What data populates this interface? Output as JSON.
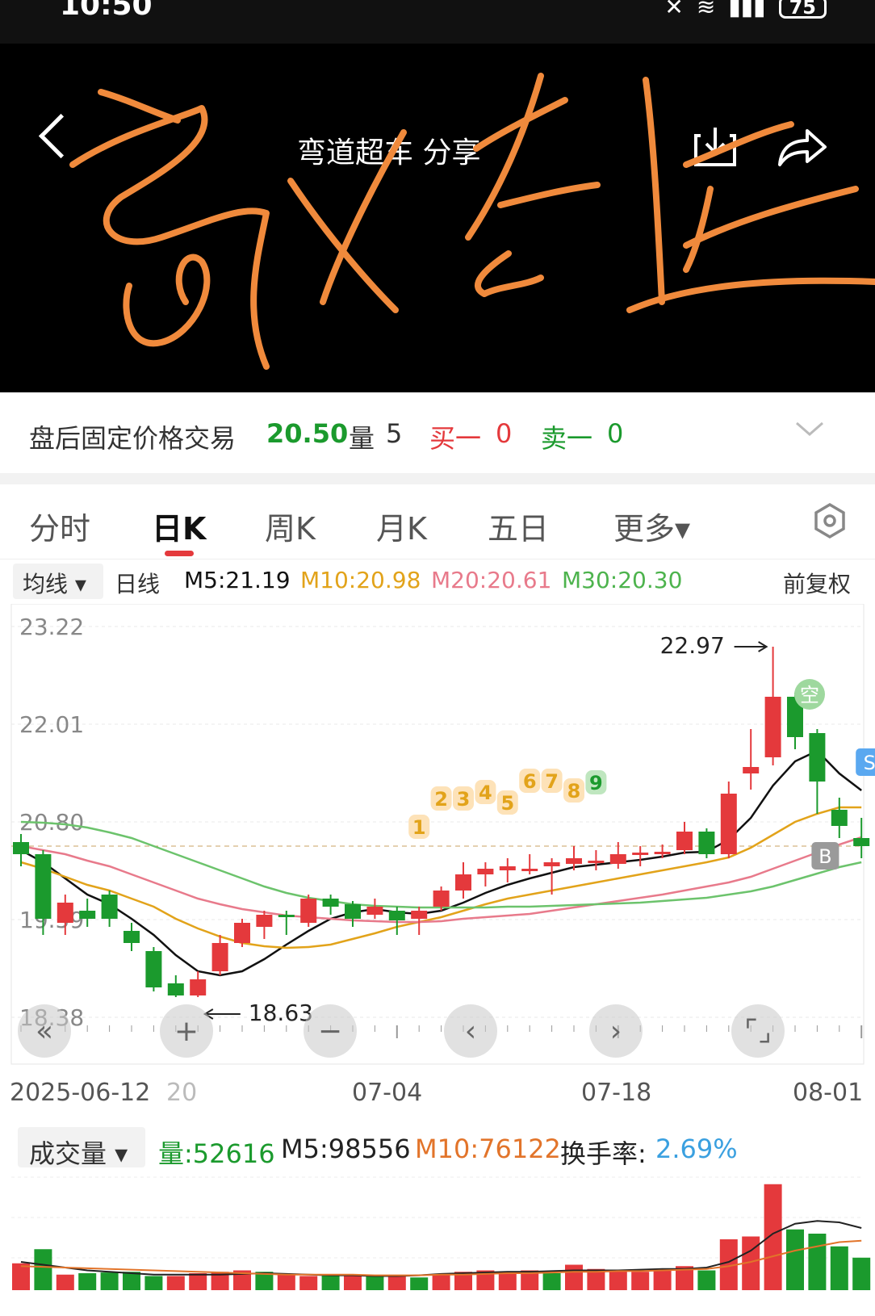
{
  "status": {
    "time": "10:50",
    "battery": "75"
  },
  "header": {
    "title": "弯道超车 分享"
  },
  "info": {
    "label": "盘后固定价格交易",
    "price": "20.50",
    "vol_label": "量",
    "vol_value": "5",
    "buy_label": "买一",
    "buy_value": "0",
    "sell_label": "卖一",
    "sell_value": "0"
  },
  "tabs": [
    "分时",
    "日K",
    "周K",
    "月K",
    "五日",
    "更多▾"
  ],
  "ma": {
    "selector": "均线 ▾",
    "type": "日线",
    "m5": "M5:21.19",
    "m10": "M10:20.98",
    "m20": "M20:20.61",
    "m30": "M30:20.30",
    "adjust": "前复权"
  },
  "colors": {
    "up": "#e4393c",
    "down": "#1b9a2d",
    "m5": "#111111",
    "m10": "#e2a31a",
    "m20": "#e87a8b",
    "m30": "#6cc36c"
  },
  "chart_data": {
    "type": "candlestick",
    "y_ticks": [
      "23.22",
      "22.01",
      "20.80",
      "19.59",
      "18.38"
    ],
    "ylim": [
      18.38,
      23.22
    ],
    "x_labels": [
      "2025-06-12",
      "20",
      "07-04",
      "07-18",
      "08-01"
    ],
    "high_label": "22.97",
    "low_label": "18.63",
    "markers": [
      "1",
      "2",
      "3",
      "4",
      "5",
      "6",
      "7",
      "8",
      "9"
    ],
    "signal_labels": [
      "空",
      "S",
      "B"
    ],
    "candles": [
      {
        "o": 20.55,
        "h": 20.65,
        "l": 20.25,
        "c": 20.4
      },
      {
        "o": 20.4,
        "h": 20.45,
        "l": 19.4,
        "c": 19.6
      },
      {
        "o": 19.55,
        "h": 19.9,
        "l": 19.4,
        "c": 19.8
      },
      {
        "o": 19.7,
        "h": 19.85,
        "l": 19.5,
        "c": 19.6
      },
      {
        "o": 19.9,
        "h": 19.95,
        "l": 19.5,
        "c": 19.6
      },
      {
        "o": 19.45,
        "h": 19.55,
        "l": 19.2,
        "c": 19.3
      },
      {
        "o": 19.2,
        "h": 19.25,
        "l": 18.7,
        "c": 18.75
      },
      {
        "o": 18.8,
        "h": 18.9,
        "l": 18.63,
        "c": 18.65
      },
      {
        "o": 18.65,
        "h": 18.95,
        "l": 18.63,
        "c": 18.85
      },
      {
        "o": 18.95,
        "h": 19.4,
        "l": 18.9,
        "c": 19.3
      },
      {
        "o": 19.3,
        "h": 19.6,
        "l": 19.25,
        "c": 19.55
      },
      {
        "o": 19.5,
        "h": 19.7,
        "l": 19.35,
        "c": 19.65
      },
      {
        "o": 19.65,
        "h": 19.7,
        "l": 19.4,
        "c": 19.63
      },
      {
        "o": 19.55,
        "h": 19.9,
        "l": 19.5,
        "c": 19.85
      },
      {
        "o": 19.85,
        "h": 19.9,
        "l": 19.65,
        "c": 19.75
      },
      {
        "o": 19.78,
        "h": 19.82,
        "l": 19.5,
        "c": 19.6
      },
      {
        "o": 19.65,
        "h": 19.85,
        "l": 19.6,
        "c": 19.75
      },
      {
        "o": 19.7,
        "h": 19.75,
        "l": 19.4,
        "c": 19.58
      },
      {
        "o": 19.6,
        "h": 19.75,
        "l": 19.4,
        "c": 19.7
      },
      {
        "o": 19.75,
        "h": 20.0,
        "l": 19.7,
        "c": 19.95
      },
      {
        "o": 19.95,
        "h": 20.3,
        "l": 19.85,
        "c": 20.15
      },
      {
        "o": 20.15,
        "h": 20.3,
        "l": 20.0,
        "c": 20.22
      },
      {
        "o": 20.2,
        "h": 20.35,
        "l": 20.05,
        "c": 20.25
      },
      {
        "o": 20.2,
        "h": 20.4,
        "l": 20.15,
        "c": 20.22
      },
      {
        "o": 20.25,
        "h": 20.35,
        "l": 19.9,
        "c": 20.3
      },
      {
        "o": 20.28,
        "h": 20.5,
        "l": 20.2,
        "c": 20.35
      },
      {
        "o": 20.3,
        "h": 20.45,
        "l": 20.2,
        "c": 20.32
      },
      {
        "o": 20.28,
        "h": 20.55,
        "l": 20.22,
        "c": 20.4
      },
      {
        "o": 20.4,
        "h": 20.5,
        "l": 20.25,
        "c": 20.42
      },
      {
        "o": 20.4,
        "h": 20.52,
        "l": 20.35,
        "c": 20.43
      },
      {
        "o": 20.45,
        "h": 20.8,
        "l": 20.4,
        "c": 20.68
      },
      {
        "o": 20.68,
        "h": 20.72,
        "l": 20.35,
        "c": 20.4
      },
      {
        "o": 20.4,
        "h": 21.3,
        "l": 20.35,
        "c": 21.15
      },
      {
        "o": 21.4,
        "h": 21.95,
        "l": 21.2,
        "c": 21.48
      },
      {
        "o": 21.6,
        "h": 22.97,
        "l": 21.5,
        "c": 22.35
      },
      {
        "o": 22.35,
        "h": 22.4,
        "l": 21.7,
        "c": 21.85
      },
      {
        "o": 21.9,
        "h": 21.95,
        "l": 20.9,
        "c": 21.3
      },
      {
        "o": 20.95,
        "h": 21.1,
        "l": 20.6,
        "c": 20.75
      },
      {
        "o": 20.6,
        "h": 20.85,
        "l": 20.35,
        "c": 20.5
      }
    ],
    "ma_series": [
      {
        "name": "M5",
        "values": [
          20.45,
          20.3,
          20.1,
          19.9,
          19.78,
          19.6,
          19.4,
          19.15,
          18.95,
          18.9,
          18.95,
          19.1,
          19.28,
          19.45,
          19.6,
          19.68,
          19.72,
          19.68,
          19.66,
          19.7,
          19.8,
          19.92,
          20.02,
          20.1,
          20.17,
          20.24,
          20.27,
          20.3,
          20.33,
          20.37,
          20.42,
          20.43,
          20.58,
          20.85,
          21.25,
          21.55,
          21.68,
          21.4,
          21.19
        ]
      },
      {
        "name": "M10",
        "values": [
          20.3,
          20.22,
          20.12,
          20.02,
          19.95,
          19.85,
          19.75,
          19.6,
          19.48,
          19.38,
          19.3,
          19.26,
          19.24,
          19.25,
          19.28,
          19.35,
          19.42,
          19.5,
          19.56,
          19.62,
          19.7,
          19.78,
          19.85,
          19.9,
          19.95,
          20.0,
          20.05,
          20.1,
          20.15,
          20.2,
          20.25,
          20.3,
          20.36,
          20.48,
          20.64,
          20.8,
          20.9,
          20.98,
          20.98
        ]
      },
      {
        "name": "M20",
        "values": [
          20.5,
          20.45,
          20.4,
          20.32,
          20.25,
          20.15,
          20.05,
          19.95,
          19.85,
          19.78,
          19.72,
          19.68,
          19.64,
          19.62,
          19.6,
          19.58,
          19.57,
          19.56,
          19.56,
          19.57,
          19.6,
          19.62,
          19.64,
          19.66,
          19.7,
          19.74,
          19.78,
          19.82,
          19.86,
          19.9,
          19.95,
          20.0,
          20.05,
          20.12,
          20.22,
          20.32,
          20.42,
          20.52,
          20.61
        ]
      },
      {
        "name": "M30",
        "values": [
          20.8,
          20.79,
          20.77,
          20.73,
          20.67,
          20.6,
          20.5,
          20.4,
          20.3,
          20.2,
          20.1,
          20.0,
          19.92,
          19.86,
          19.82,
          19.78,
          19.76,
          19.75,
          19.74,
          19.74,
          19.74,
          19.74,
          19.75,
          19.75,
          19.76,
          19.77,
          19.78,
          19.79,
          19.8,
          19.82,
          19.84,
          19.86,
          19.9,
          19.94,
          20.0,
          20.08,
          20.16,
          20.24,
          20.3
        ]
      }
    ]
  },
  "x_dates": {
    "d0": "2025-06-12",
    "d1": "20",
    "d2": "07-04",
    "d3": "07-18",
    "d4": "08-01"
  },
  "volume": {
    "selector": "成交量 ▾",
    "vol": "量:52616",
    "m5": "M5:98556",
    "m10": "M10:76122",
    "turnover_label": "换手率:",
    "turnover": "2.69%",
    "bars": [
      38,
      58,
      22,
      24,
      25,
      26,
      20,
      20,
      24,
      26,
      28,
      26,
      22,
      20,
      22,
      22,
      20,
      20,
      18,
      22,
      26,
      28,
      26,
      28,
      24,
      36,
      30,
      28,
      26,
      28,
      34,
      28,
      72,
      76,
      150,
      86,
      80,
      62,
      46
    ],
    "up": [
      1,
      0,
      1,
      0,
      0,
      0,
      0,
      1,
      1,
      1,
      1,
      0,
      1,
      1,
      0,
      1,
      0,
      1,
      0,
      1,
      1,
      1,
      1,
      1,
      0,
      1,
      1,
      1,
      1,
      1,
      1,
      0,
      1,
      1,
      1,
      0,
      0,
      0,
      0
    ],
    "ma5": [
      40,
      36,
      32,
      28,
      26,
      24,
      22,
      22,
      22,
      22,
      23,
      24,
      23,
      22,
      21,
      21,
      20,
      20,
      21,
      23,
      24,
      25,
      26,
      26,
      27,
      28,
      28,
      28,
      29,
      30,
      30,
      32,
      40,
      56,
      80,
      94,
      98,
      96,
      88
    ],
    "ma10": [
      34,
      33,
      32,
      31,
      30,
      29,
      28,
      27,
      26,
      25,
      24,
      23,
      22,
      22,
      22,
      22,
      21,
      21,
      21,
      22,
      22,
      23,
      24,
      24,
      25,
      26,
      26,
      27,
      27,
      28,
      29,
      30,
      34,
      40,
      48,
      56,
      62,
      68,
      70
    ]
  }
}
